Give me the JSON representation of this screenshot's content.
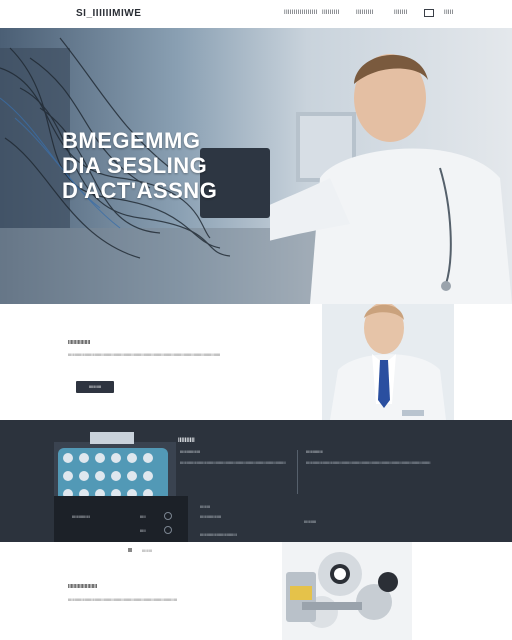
{
  "nav": {
    "logo": "SI_IIIIIIMIWE",
    "links": [
      "IIIIIIIIIIIIIIIII",
      "IIIIIIIII",
      "IIIIIIIII",
      "IIIIIII",
      "IIIII"
    ]
  },
  "hero": {
    "title_lines": [
      "BMEGEMMG",
      "DIA  SESLING",
      "D'ACT'ASSNG"
    ]
  },
  "intro": {
    "heading": "IIIIIIIIIIIIIIII",
    "text": "IIIIIIIIIIIIIIIIIIIIIIIIIIIIIIIIIIIIIIIIIIIIIIIIIIIIIIIIIIIIIIIIIIIIIIIIIIIIIIIIIIIIIIIIIIIIIIIIIIIIIIIIIIIIIIIIIIIIIIIIIIIIIIIIIIIIIIIII",
    "button_label": "IIIIIIIIIII"
  },
  "dark": {
    "heading": "IIIIIIIIII",
    "col1_title": "IIIIIIIIIIIIIIIIII",
    "col1_text": "IIIIIIIIIIIIIIIIIIIIIIIIIIIIIIIIIIIIIIIIIIIIIIIIIIIIIIIIIIIIIIIIIIIIIIIIIIIIIIIIIIIIIIIIIIIIIII",
    "col2_title": "IIIIIIIIIIIIIII",
    "col2_text": "IIIIIIIIIIIIIIIIIIIIIIIIIIIIIIIIIIIIIIIIIIIIIIIIIIIIIIIIIIIIIIIIIIIIIIIIIIIIIIIIIIIIIIIIIIIIIIIIIIIIIIIIIIIIIIII",
    "strip_labels": [
      "IIIIIIIIIIIIIIII",
      "IIIII",
      "IIIII"
    ],
    "small": [
      "IIIIIIIII",
      "IIIIIIIIIIIIIIIIIII",
      "IIIIIIIIIIIIIIIIIIIIIIIIIIIIIIIII",
      "IIIIIIIIIII"
    ]
  },
  "bottom": {
    "small": "IIIIIIIII",
    "heading": "IIIIIIIIIIIIIIIIIIIII",
    "text": "IIIIIIIIIIIIIIIIIIIIIIIIIIIIIIIIIIIIIIIIIIIIIIIIIIIIIIIIIIIIIIIIIIIIIIIIIIIIIIIIIIIIIIIIIIIIIIIIII"
  },
  "colors": {
    "dark_band": "#2c333d",
    "button": "#2e3440",
    "device_accent": "#4fb3d9"
  },
  "icons": [
    "menu-icon",
    "chevron-icon",
    "settings-icon",
    "dot-icon"
  ]
}
